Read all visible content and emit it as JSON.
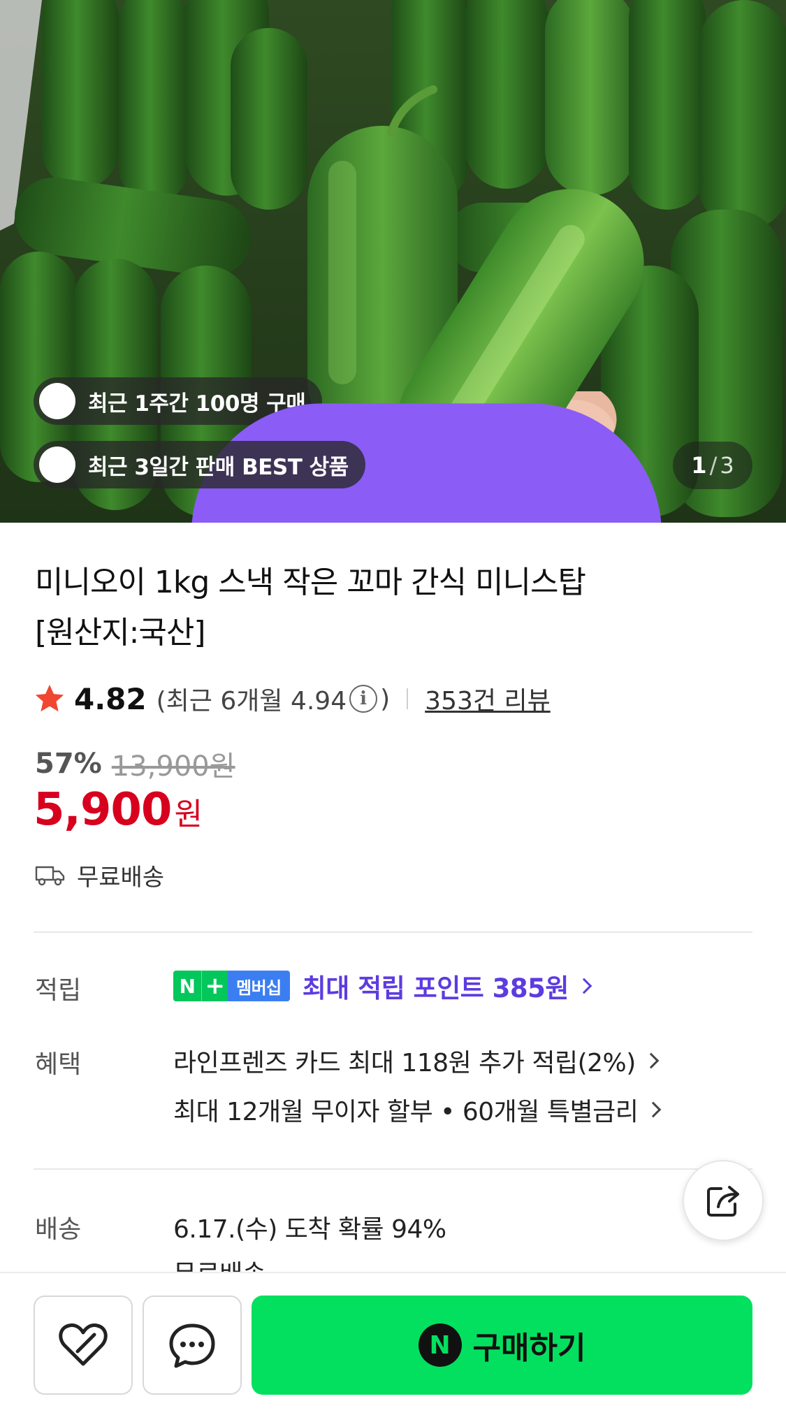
{
  "hero": {
    "image_alt": "",
    "badges": [
      {
        "icon": "shopping-bag-icon",
        "text": "최근 1주간 100명 구매",
        "icon_color": "#8b5cf6"
      },
      {
        "icon": "gift-icon",
        "text": "최근 3일간 판매 BEST 상품",
        "icon_color": "#f0465a"
      }
    ],
    "counter": {
      "current": "1",
      "separator": "/",
      "total": "3"
    }
  },
  "product": {
    "title_line1": "미니오이 1kg 스낵 작은 꼬마 간식 미니스탑",
    "title_line2": "[원산지:국산]",
    "rating": "4.82",
    "recent_rating_prefix": "(최근 6개월 4.94",
    "recent_rating_suffix": ")",
    "info_glyph": "i",
    "review_count": "353건 리뷰",
    "discount": "57%",
    "original_price": "13,900원",
    "price": "5,900",
    "price_unit": "원",
    "shipping": "무료배송"
  },
  "benefits": {
    "points_label": "적립",
    "membership_n": "N",
    "membership_plus": "+",
    "membership_text": "멤버십",
    "points_text": "최대 적립 포인트 385원",
    "benefit_label": "혜택",
    "benefit_1": "라인프렌즈 카드 최대 118원 추가 적립(2%)",
    "benefit_2": "최대 12개월 무이자 할부 • 60개월 특별금리",
    "delivery_label": "배송",
    "delivery_text": "6.17.(수) 도착 확률 94%",
    "delivery_sub": "무료배송"
  },
  "bottom": {
    "buy_n": "N",
    "buy_label": "구매하기"
  },
  "colors": {
    "price_red": "#d7001e",
    "points_purple": "#5c3ce0",
    "buy_green": "#03e05f",
    "naver_green": "#03c75a"
  }
}
